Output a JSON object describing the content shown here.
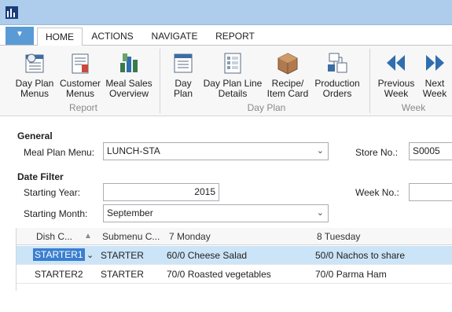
{
  "ribbon": {
    "tabs": [
      "HOME",
      "ACTIONS",
      "NAVIGATE",
      "REPORT"
    ],
    "buttons": {
      "day_plan_menus": [
        "Day Plan",
        "Menus"
      ],
      "customer_menus": [
        "Customer",
        "Menus"
      ],
      "meal_sales_overview": [
        "Meal Sales",
        "Overview"
      ],
      "day_plan": [
        "Day",
        "Plan"
      ],
      "day_plan_line_details": [
        "Day Plan Line",
        "Details"
      ],
      "recipe_item_card": [
        "Recipe/",
        "Item Card"
      ],
      "production_orders": [
        "Production",
        "Orders"
      ],
      "previous_week": [
        "Previous",
        "Week"
      ],
      "next_week": [
        "Next",
        "Week"
      ]
    },
    "groups": {
      "report": "Report",
      "day_plan": "Day Plan",
      "week": "Week"
    }
  },
  "general": {
    "title": "General",
    "meal_plan_menu_label": "Meal Plan Menu:",
    "meal_plan_menu_value": "LUNCH-STA",
    "store_no_label": "Store No.:",
    "store_no_value": "S0005"
  },
  "date_filter": {
    "title": "Date Filter",
    "starting_year_label": "Starting Year:",
    "starting_year_value": "2015",
    "week_no_label": "Week No.:",
    "week_no_value": "",
    "starting_month_label": "Starting Month:",
    "starting_month_value": "September"
  },
  "grid": {
    "headers": [
      "Dish C...",
      "Submenu C...",
      "7 Monday",
      "8 Tuesday"
    ],
    "rows": [
      [
        "STARTER1",
        "STARTER",
        "60/0 Cheese Salad",
        "50/0 Nachos to share"
      ],
      [
        "STARTER2",
        "STARTER",
        "70/0 Roasted vegetables",
        "70/0 Parma Ham"
      ]
    ]
  },
  "colors": {
    "titlebar": "#aeccec",
    "accent": "#5a9bd5",
    "selection": "#cce4f7",
    "icon_blue": "#1f4e8c"
  }
}
